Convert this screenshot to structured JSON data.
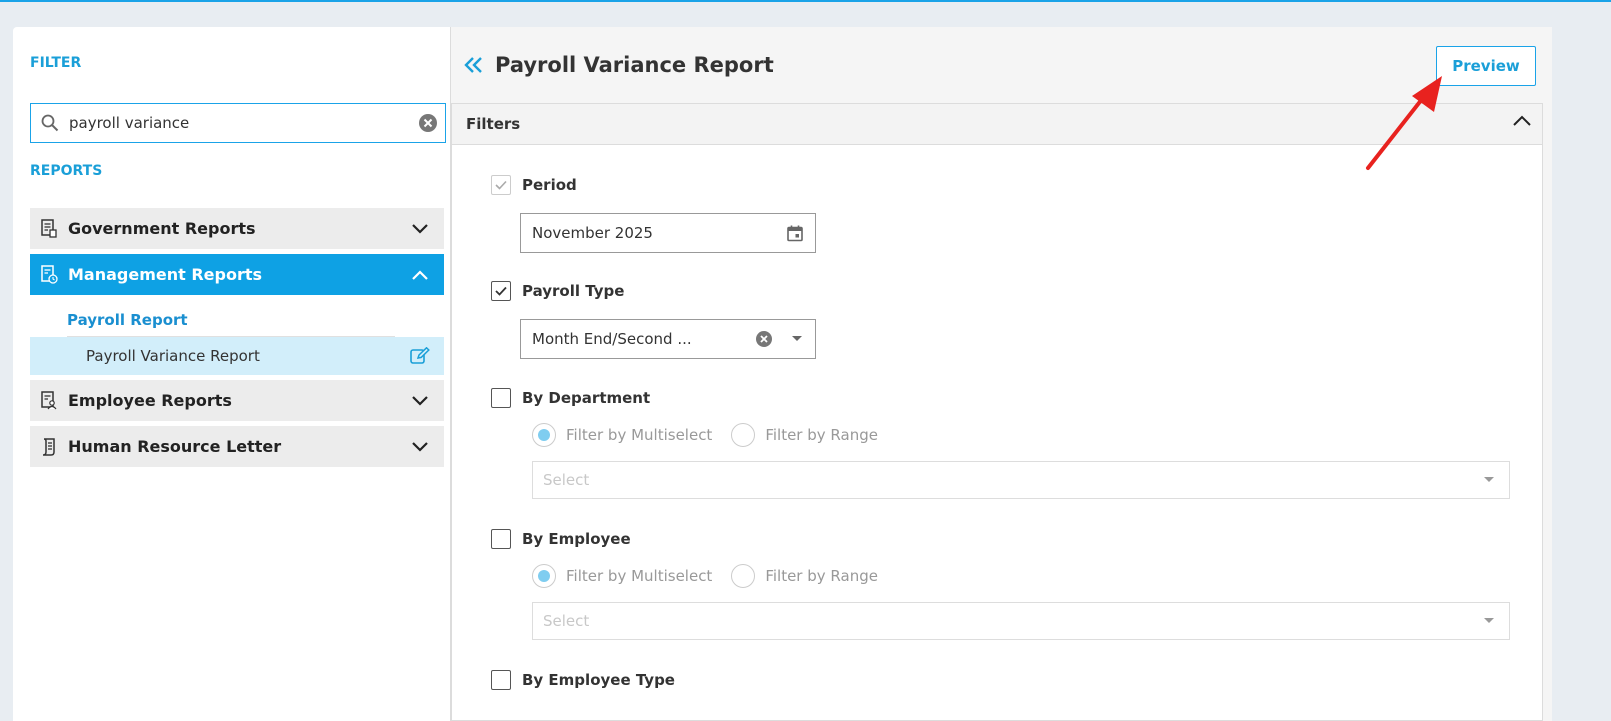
{
  "sidebar": {
    "filter_title": "FILTER",
    "search": {
      "value": "payroll variance",
      "placeholder": ""
    },
    "reports_title": "REPORTS",
    "groups": [
      {
        "label": "Government Reports",
        "expanded": false
      },
      {
        "label": "Management Reports",
        "expanded": true
      },
      {
        "label": "Employee Reports",
        "expanded": false
      },
      {
        "label": "Human Resource Letter",
        "expanded": false
      }
    ],
    "sub_group_title": "Payroll Report",
    "sub_item": "Payroll Variance Report"
  },
  "main": {
    "title": "Payroll Variance Report",
    "preview_label": "Preview",
    "filters_title": "Filters",
    "period": {
      "label": "Period",
      "value": "November 2025",
      "checked": true
    },
    "payroll_type": {
      "label": "Payroll Type",
      "value": "Month End/Second ...",
      "checked": true
    },
    "by_department": {
      "label": "By Department",
      "radio_multiselect": "Filter by Multiselect",
      "radio_range": "Filter by Range",
      "select_placeholder": "Select"
    },
    "by_employee": {
      "label": "By Employee",
      "radio_multiselect": "Filter by Multiselect",
      "radio_range": "Filter by Range",
      "select_placeholder": "Select"
    },
    "by_employee_type": {
      "label": "By Employee Type"
    }
  },
  "colors": {
    "accent": "#0ea1e4",
    "selected_item": "#d2eefa",
    "annotation_arrow": "#e8221f"
  }
}
